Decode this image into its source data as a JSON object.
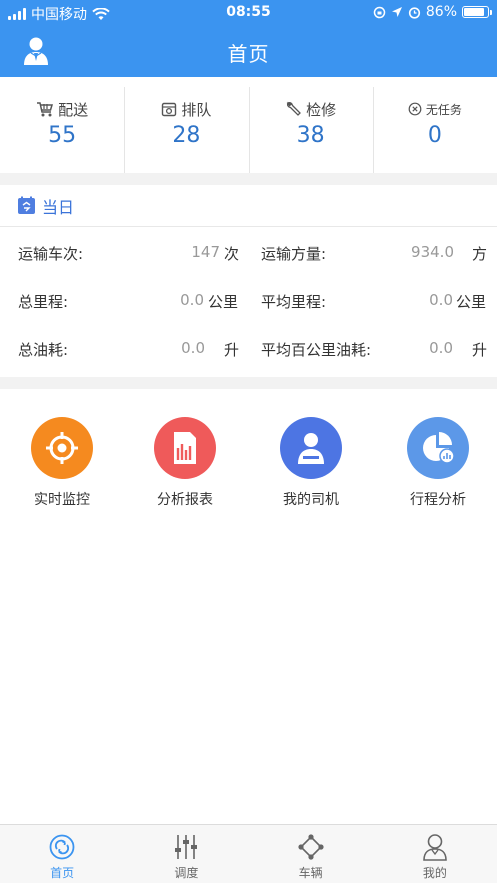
{
  "status_bar": {
    "carrier": "中国移动",
    "time": "08:55",
    "battery": "86%",
    "battery_level": 0.86
  },
  "nav": {
    "title": "首页"
  },
  "stats": [
    {
      "label": "配送",
      "value": "55",
      "icon": "cart-icon"
    },
    {
      "label": "排队",
      "value": "28",
      "icon": "queue-icon"
    },
    {
      "label": "检修",
      "value": "38",
      "icon": "wrench-icon"
    },
    {
      "label": "无任务",
      "value": "0",
      "icon": "no-task-icon"
    }
  ],
  "today": {
    "title": "当日",
    "rows": [
      {
        "left": {
          "label": "运输车次:",
          "value": "147",
          "unit": "次"
        },
        "right": {
          "label": "运输方量:",
          "value": "934.0",
          "unit": "方"
        }
      },
      {
        "left": {
          "label": "总里程:",
          "value": "0.0",
          "unit": "公里"
        },
        "right": {
          "label": "平均里程:",
          "value": "0.0",
          "unit": "公里"
        }
      },
      {
        "left": {
          "label": "总油耗:",
          "value": "0.0",
          "unit": "升"
        },
        "right": {
          "label": "平均百公里油耗:",
          "value": "0.0",
          "unit": "升"
        }
      }
    ]
  },
  "grid": [
    {
      "label": "实时监控",
      "icon": "target-icon",
      "color": "#f58a1f"
    },
    {
      "label": "分析报表",
      "icon": "report-icon",
      "color": "#ef5a5a"
    },
    {
      "label": "我的司机",
      "icon": "driver-icon",
      "color": "#4d75e3"
    },
    {
      "label": "行程分析",
      "icon": "pie-chart-icon",
      "color": "#5c98e8"
    }
  ],
  "tabs": [
    {
      "label": "首页",
      "icon": "home-icon",
      "active": true
    },
    {
      "label": "调度",
      "icon": "sliders-icon",
      "active": false
    },
    {
      "label": "车辆",
      "icon": "vehicle-icon",
      "active": false
    },
    {
      "label": "我的",
      "icon": "profile-icon",
      "active": false
    }
  ],
  "colors": {
    "primary": "#3b94f0",
    "value_blue": "#2f74c8"
  }
}
